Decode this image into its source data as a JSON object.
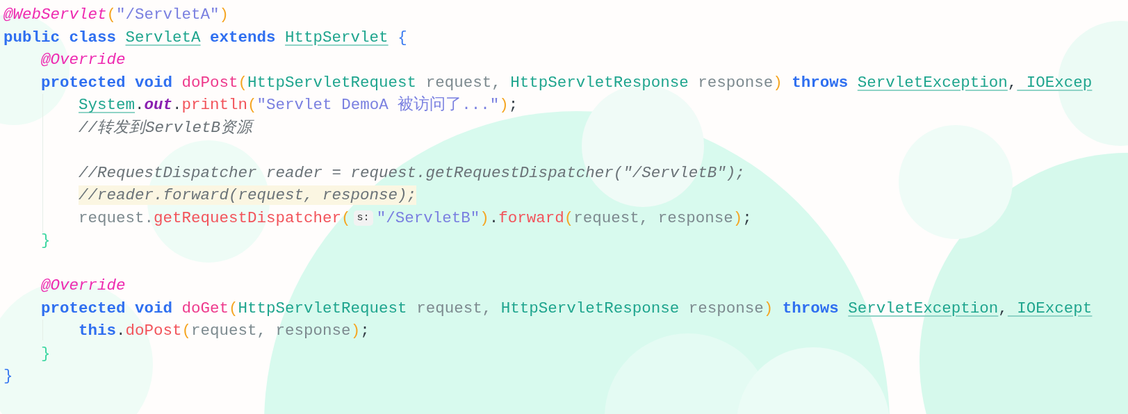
{
  "editor": {
    "lines": [
      {
        "kind": "code",
        "segments": [
          {
            "kind": "code",
            "tokens": [
              {
                "t": "@WebServlet",
                "kind": "annotation"
              },
              {
                "t": "(",
                "kind": "paren"
              },
              {
                "t": "\"/ServletA\"",
                "kind": "string"
              },
              {
                "t": ")",
                "kind": "paren"
              }
            ]
          }
        ]
      },
      {
        "kind": "code",
        "segments": [
          {
            "kind": "code",
            "tokens": [
              {
                "t": "public class ",
                "kind": "keyword"
              },
              {
                "t": "ServletA",
                "kind": "type"
              },
              {
                "t": " extends ",
                "kind": "keyword"
              },
              {
                "t": "HttpServlet",
                "kind": "type"
              },
              {
                "t": " {",
                "kind": "brace"
              }
            ]
          }
        ],
        "children": [
          {
            "kind": "code",
            "segments": [
              {
                "kind": "code",
                "tokens": [
                  {
                    "t": "@Override",
                    "kind": "annotation"
                  }
                ]
              }
            ]
          },
          {
            "kind": "code",
            "segments": [
              {
                "kind": "code",
                "tokens": [
                  {
                    "t": "protected void ",
                    "kind": "keyword"
                  },
                  {
                    "t": "doPost",
                    "kind": "declaration"
                  },
                  {
                    "t": "(",
                    "kind": "paren"
                  },
                  {
                    "t": "HttpServletRequest",
                    "kind": "class"
                  },
                  {
                    "t": " request, ",
                    "kind": "param"
                  },
                  {
                    "t": "HttpServletResponse",
                    "kind": "class"
                  },
                  {
                    "t": " response",
                    "kind": "param"
                  },
                  {
                    "t": ")",
                    "kind": "paren"
                  },
                  {
                    "t": " throws ",
                    "kind": "keyword"
                  },
                  {
                    "t": "ServletException",
                    "kind": "type"
                  },
                  {
                    "t": ",",
                    "kind": "plain"
                  },
                  {
                    "t": " IOExcep",
                    "kind": "type"
                  }
                ]
              }
            ],
            "children": [
              {
                "kind": "code",
                "segments": [
                  {
                    "kind": "code",
                    "tokens": [
                      {
                        "t": "System",
                        "kind": "type"
                      },
                      {
                        "t": ".",
                        "kind": "plain"
                      },
                      {
                        "t": "out",
                        "kind": "field"
                      },
                      {
                        "t": ".",
                        "kind": "plain"
                      },
                      {
                        "t": "println",
                        "kind": "method"
                      },
                      {
                        "t": "(",
                        "kind": "paren"
                      },
                      {
                        "t": "\"Servlet DemoA 被访问了...\"",
                        "kind": "string"
                      },
                      {
                        "t": ")",
                        "kind": "paren"
                      },
                      {
                        "t": ";",
                        "kind": "plain"
                      }
                    ]
                  }
                ]
              },
              {
                "kind": "code",
                "segments": [
                  {
                    "kind": "code",
                    "tokens": [
                      {
                        "t": "//转发到ServletB资源",
                        "kind": "comment"
                      }
                    ]
                  }
                ]
              },
              {
                "kind": "blank"
              },
              {
                "kind": "code",
                "segments": [
                  {
                    "kind": "code",
                    "tokens": [
                      {
                        "t": "//RequestDispatcher reader = request.getRequestDispatcher(\"/ServletB\");",
                        "kind": "comment"
                      }
                    ]
                  }
                ]
              },
              {
                "kind": "code",
                "highlighted": true,
                "segments": [
                  {
                    "kind": "code",
                    "tokens": [
                      {
                        "t": "//reader.forward(request, response);",
                        "kind": "comment"
                      }
                    ]
                  }
                ]
              },
              {
                "kind": "code",
                "segments": [
                  {
                    "kind": "code",
                    "tokens": [
                      {
                        "t": "request.",
                        "kind": "param"
                      },
                      {
                        "t": "getRequestDispatcher",
                        "kind": "method"
                      },
                      {
                        "t": "(",
                        "kind": "paren"
                      }
                    ]
                  },
                  {
                    "kind": "hint",
                    "text": "s:"
                  },
                  {
                    "kind": "code",
                    "tokens": [
                      {
                        "t": "\"/ServletB\"",
                        "kind": "string"
                      },
                      {
                        "t": ")",
                        "kind": "paren"
                      },
                      {
                        "t": ".",
                        "kind": "plain"
                      },
                      {
                        "t": "forward",
                        "kind": "method"
                      },
                      {
                        "t": "(",
                        "kind": "paren"
                      },
                      {
                        "t": "request, response",
                        "kind": "param"
                      },
                      {
                        "t": ")",
                        "kind": "paren"
                      },
                      {
                        "t": ";",
                        "kind": "plain"
                      }
                    ]
                  }
                ]
              }
            ]
          },
          {
            "kind": "code",
            "segments": [
              {
                "kind": "code",
                "tokens": [
                  {
                    "t": "}",
                    "kind": "block"
                  }
                ]
              }
            ]
          },
          {
            "kind": "blank"
          },
          {
            "kind": "code",
            "segments": [
              {
                "kind": "code",
                "tokens": [
                  {
                    "t": "@Override",
                    "kind": "annotation"
                  }
                ]
              }
            ]
          },
          {
            "kind": "code",
            "segments": [
              {
                "kind": "code",
                "tokens": [
                  {
                    "t": "protected void ",
                    "kind": "keyword"
                  },
                  {
                    "t": "doGet",
                    "kind": "declaration"
                  },
                  {
                    "t": "(",
                    "kind": "paren"
                  },
                  {
                    "t": "HttpServletRequest",
                    "kind": "class"
                  },
                  {
                    "t": " request, ",
                    "kind": "param"
                  },
                  {
                    "t": "HttpServletResponse",
                    "kind": "class"
                  },
                  {
                    "t": " response",
                    "kind": "param"
                  },
                  {
                    "t": ")",
                    "kind": "paren"
                  },
                  {
                    "t": " throws ",
                    "kind": "keyword"
                  },
                  {
                    "t": "ServletException",
                    "kind": "type"
                  },
                  {
                    "t": ",",
                    "kind": "plain"
                  },
                  {
                    "t": " IOExcept",
                    "kind": "type"
                  }
                ]
              }
            ],
            "children": [
              {
                "kind": "code",
                "segments": [
                  {
                    "kind": "code",
                    "tokens": [
                      {
                        "t": "this",
                        "kind": "keyword"
                      },
                      {
                        "t": ".",
                        "kind": "plain"
                      },
                      {
                        "t": "doPost",
                        "kind": "method"
                      },
                      {
                        "t": "(",
                        "kind": "paren"
                      },
                      {
                        "t": "request, response",
                        "kind": "param"
                      },
                      {
                        "t": ")",
                        "kind": "paren"
                      },
                      {
                        "t": ";",
                        "kind": "plain"
                      }
                    ]
                  }
                ]
              }
            ]
          },
          {
            "kind": "code",
            "segments": [
              {
                "kind": "code",
                "tokens": [
                  {
                    "t": "}",
                    "kind": "block"
                  }
                ]
              }
            ]
          }
        ]
      },
      {
        "kind": "code",
        "segments": [
          {
            "kind": "code",
            "tokens": [
              {
                "t": "}",
                "kind": "brace"
              }
            ]
          }
        ]
      }
    ]
  }
}
